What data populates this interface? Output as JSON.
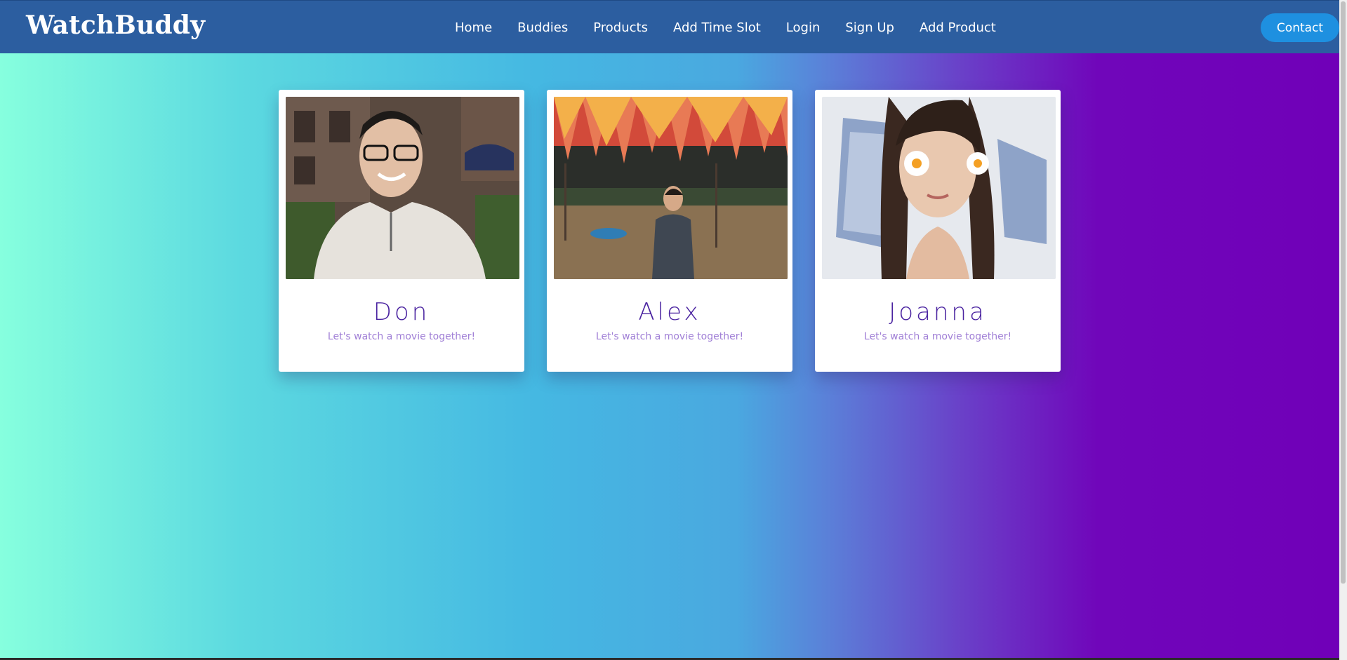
{
  "app": {
    "brand": "WatchBuddy"
  },
  "nav": {
    "links": [
      "Home",
      "Buddies",
      "Products",
      "Add Time Slot",
      "Login",
      "Sign Up",
      "Add Product"
    ],
    "contact_label": "Contact"
  },
  "buddies": [
    {
      "name": "Don",
      "tagline": "Let's watch a movie together!"
    },
    {
      "name": "Alex",
      "tagline": "Let's watch a movie together!"
    },
    {
      "name": "Joanna",
      "tagline": "Let's watch a movie together!"
    }
  ],
  "colors": {
    "navbar": "#2c5ea0",
    "accent": "#1e90e0",
    "name_text": "#4a23a0",
    "tagline_text": "#a07fd6",
    "gradient_start": "#86ffde",
    "gradient_end": "#7000b8"
  }
}
